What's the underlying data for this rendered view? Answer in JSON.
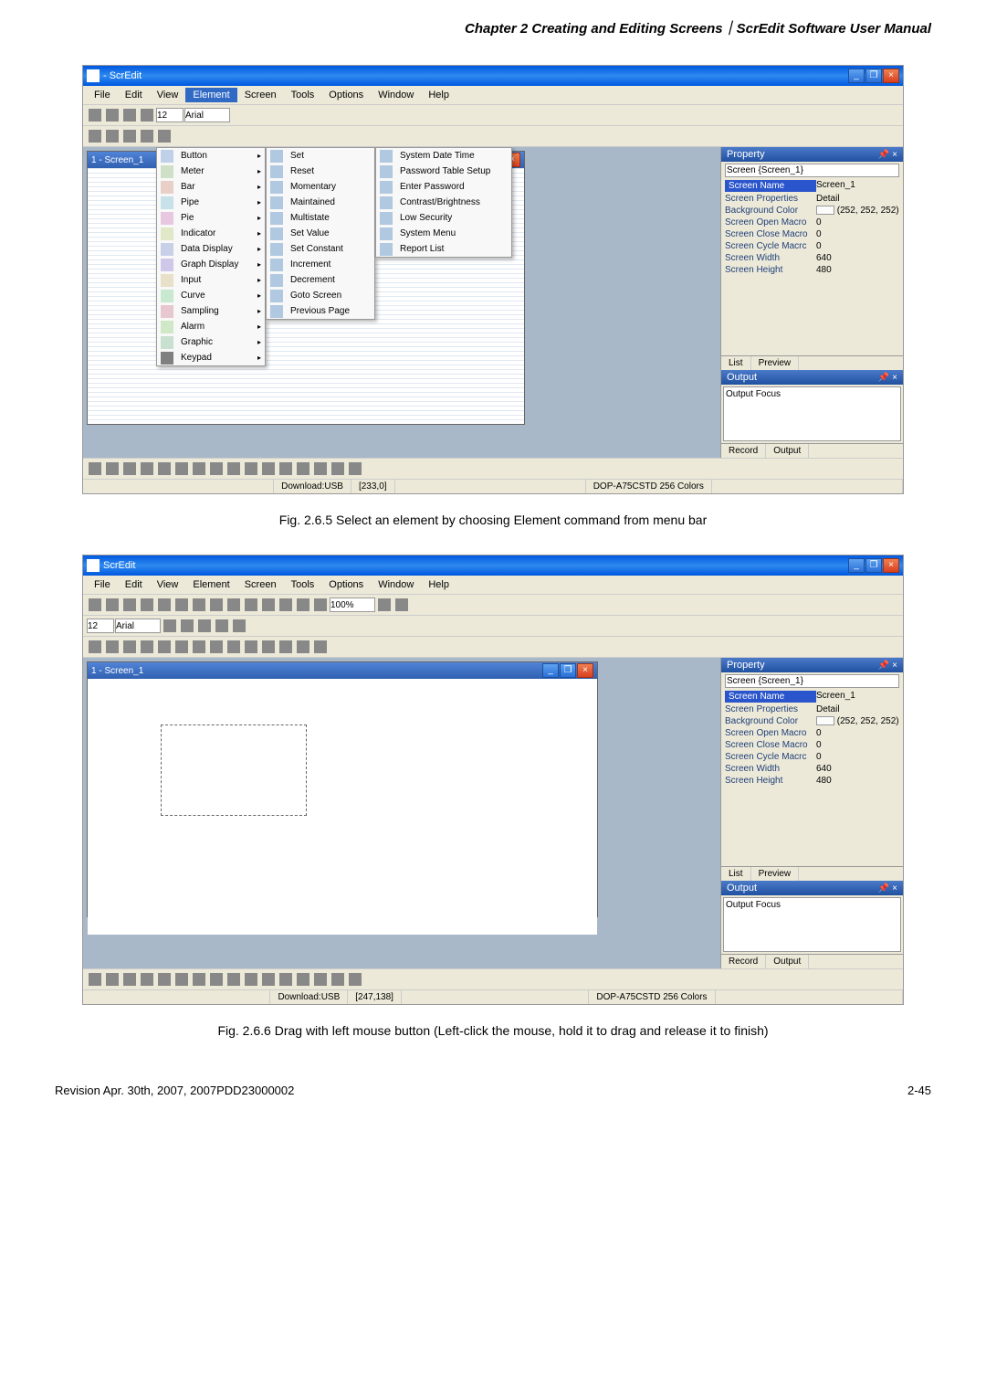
{
  "page_header": "Chapter 2  Creating and Editing Screens｜ScrEdit Software User Manual",
  "fig1_caption": "Fig. 2.6.5 Select an element by choosing Element command from menu bar",
  "fig2_caption": "Fig. 2.6.6 Drag with left mouse button (Left-click the mouse, hold it to drag and release it to finish)",
  "footer_left": "Revision Apr. 30th, 2007, 2007PDD23000002",
  "footer_right": "2-45",
  "app1": {
    "title": " - ScrEdit",
    "menu": [
      "File",
      "Edit",
      "View",
      "Element",
      "Screen",
      "Tools",
      "Options",
      "Window",
      "Help"
    ],
    "active_menu": "Element",
    "element_menu": [
      "Button",
      "Meter",
      "Bar",
      "Pipe",
      "Pie",
      "Indicator",
      "Data Display",
      "Graph Display",
      "Input",
      "Curve",
      "Sampling",
      "Alarm",
      "Graphic",
      "Keypad"
    ],
    "button_submenu": [
      "Set",
      "Reset",
      "Momentary",
      "Maintained",
      "Multistate",
      "Set Value",
      "Set Constant",
      "Increment",
      "Decrement",
      "Goto Screen",
      "Previous Page"
    ],
    "button_submenu2": [
      "System Date Time",
      "Password Table Setup",
      "Enter Password",
      "Contrast/Brightness",
      "Low Security",
      "System Menu",
      "Report List"
    ],
    "inner_title": "1 - Screen_1",
    "toolbar_size": "12",
    "toolbar_font": "Arial",
    "property": {
      "title": "Property",
      "selector": "Screen {Screen_1}",
      "rows": [
        {
          "label": "Screen Name",
          "value": "Screen_1",
          "highlight": true
        },
        {
          "label": "Screen Properties",
          "value": "Detail"
        },
        {
          "label": "Background Color",
          "value": "(252, 252, 252)",
          "swatch": true
        },
        {
          "label": "Screen Open Macro",
          "value": "0"
        },
        {
          "label": "Screen Close Macro",
          "value": "0"
        },
        {
          "label": "Screen Cycle Macrc",
          "value": "0"
        },
        {
          "label": "Screen Width",
          "value": "640"
        },
        {
          "label": "Screen Height",
          "value": "480"
        }
      ]
    },
    "tabs_prop": [
      "List",
      "Preview"
    ],
    "output_title": "Output",
    "output_text": "Output Focus",
    "output_tabs": [
      "Record",
      "Output"
    ],
    "status": {
      "download": "Download:USB",
      "coords": "[233,0]",
      "device": "DOP-A75CSTD 256 Colors"
    }
  },
  "app2": {
    "title": "ScrEdit",
    "menu": [
      "File",
      "Edit",
      "View",
      "Element",
      "Screen",
      "Tools",
      "Options",
      "Window",
      "Help"
    ],
    "inner_title": "1 - Screen_1",
    "toolbar_size": "12",
    "toolbar_font": "Arial",
    "toolbar_zoom": "100%",
    "property": {
      "title": "Property",
      "selector": "Screen {Screen_1}",
      "rows": [
        {
          "label": "Screen Name",
          "value": "Screen_1",
          "highlight": true
        },
        {
          "label": "Screen Properties",
          "value": "Detail"
        },
        {
          "label": "Background Color",
          "value": "(252, 252, 252)",
          "swatch": true
        },
        {
          "label": "Screen Open Macro",
          "value": "0"
        },
        {
          "label": "Screen Close Macro",
          "value": "0"
        },
        {
          "label": "Screen Cycle Macrc",
          "value": "0"
        },
        {
          "label": "Screen Width",
          "value": "640"
        },
        {
          "label": "Screen Height",
          "value": "480"
        }
      ]
    },
    "tabs_prop": [
      "List",
      "Preview"
    ],
    "output_title": "Output",
    "output_text": "Output Focus",
    "output_tabs": [
      "Record",
      "Output"
    ],
    "status": {
      "download": "Download:USB",
      "coords": "[247,138]",
      "device": "DOP-A75CSTD 256 Colors"
    }
  }
}
